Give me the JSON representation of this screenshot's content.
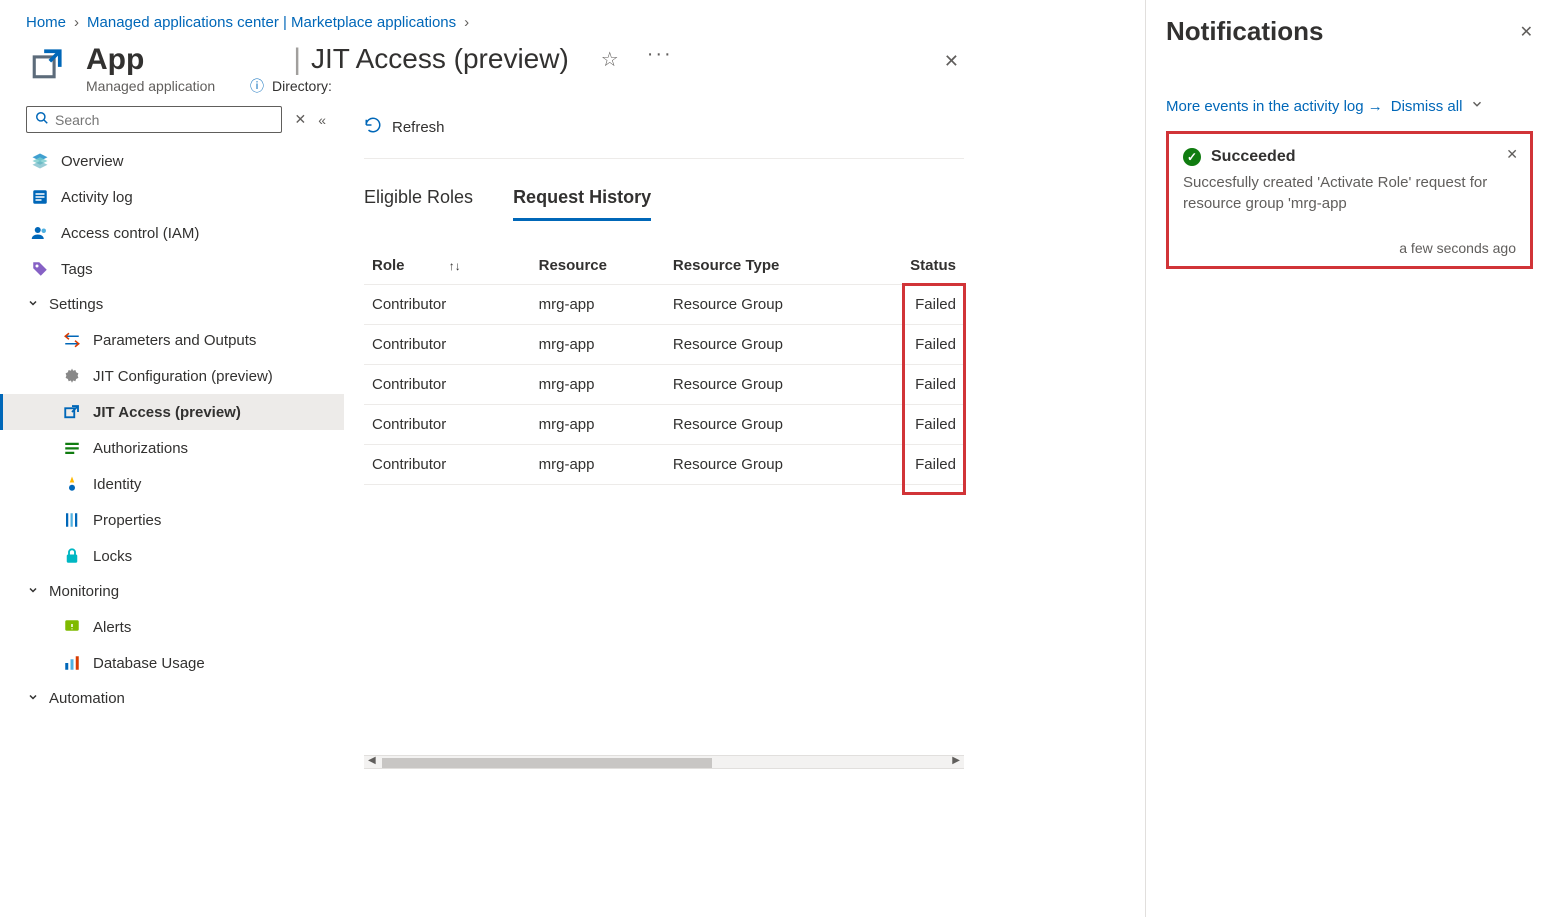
{
  "breadcrumb": {
    "home": "Home",
    "center": "Managed applications center | Marketplace applications"
  },
  "header": {
    "app_title": "App",
    "app_subtitle": "Managed application",
    "blade_title": "JIT Access (preview)",
    "directory_label": "Directory:"
  },
  "search": {
    "placeholder": "Search"
  },
  "sidebar": {
    "overview": "Overview",
    "activity_log": "Activity log",
    "iam": "Access control (IAM)",
    "tags": "Tags",
    "group_settings": "Settings",
    "params": "Parameters and Outputs",
    "jit_config": "JIT Configuration (preview)",
    "jit_access": "JIT Access (preview)",
    "authorizations": "Authorizations",
    "identity": "Identity",
    "properties": "Properties",
    "locks": "Locks",
    "group_monitoring": "Monitoring",
    "alerts": "Alerts",
    "db_usage": "Database Usage",
    "group_automation": "Automation"
  },
  "toolbar": {
    "refresh": "Refresh"
  },
  "tabs": {
    "eligible": "Eligible Roles",
    "history": "Request History"
  },
  "table": {
    "headers": {
      "role": "Role",
      "resource": "Resource",
      "rtype": "Resource Type",
      "status": "Status"
    },
    "rows": [
      {
        "role": "Contributor",
        "resource": "mrg-app",
        "rtype": "Resource Group",
        "status": "Failed"
      },
      {
        "role": "Contributor",
        "resource": "mrg-app",
        "rtype": "Resource Group",
        "status": "Failed"
      },
      {
        "role": "Contributor",
        "resource": "mrg-app",
        "rtype": "Resource Group",
        "status": "Failed"
      },
      {
        "role": "Contributor",
        "resource": "mrg-app",
        "rtype": "Resource Group",
        "status": "Failed"
      },
      {
        "role": "Contributor",
        "resource": "mrg-app",
        "rtype": "Resource Group",
        "status": "Failed"
      }
    ]
  },
  "notifications": {
    "title": "Notifications",
    "more_link": "More events in the activity log →",
    "dismiss": "Dismiss all",
    "card": {
      "title": "Succeeded",
      "body": "Succesfully created 'Activate Role' request for resource group 'mrg-app",
      "time": "a few seconds ago"
    }
  }
}
